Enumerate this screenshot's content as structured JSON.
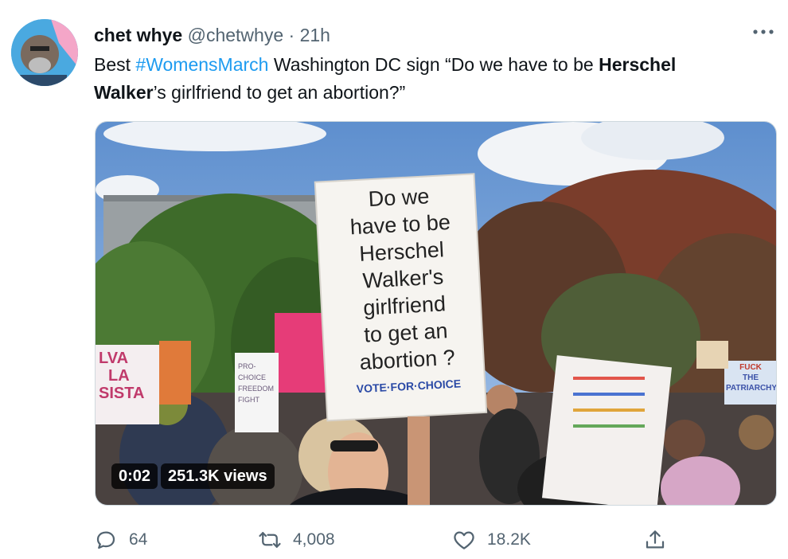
{
  "tweet": {
    "author_name": "chet whye",
    "handle": "@chetwhye",
    "separator": "·",
    "time": "21h",
    "text_part1": "Best ",
    "hashtag": "#WomensMarch",
    "text_part2": " Washington DC sign “Do we have to be ",
    "bold_part1": "Herschel",
    "bold_part2": "Walker",
    "text_part3": "’s girlfriend to get an abortion?”"
  },
  "video": {
    "time": "0:02",
    "views": "251.3K views",
    "sign": {
      "lines": [
        "Do we",
        "have to be",
        "Herschel",
        "Walker's",
        "girlfriend",
        "to get an",
        "abortion ?"
      ],
      "footer": "VOTE·FOR·CHOICE"
    },
    "left_sign": [
      "LVA",
      "LA",
      "SISTA"
    ],
    "small_sign": [
      "PRO-CHOICE",
      "FREEDOM",
      "FIGHT"
    ],
    "right_sign": [
      "FUCK",
      "THE",
      "PATRIARCHY"
    ]
  },
  "actions": {
    "replies": "64",
    "retweets": "4,008",
    "likes": "18.2K"
  },
  "colors": {
    "link": "#1d9bf0",
    "secondary": "#536471"
  },
  "icons": [
    "avatar",
    "more-icon",
    "reply-icon",
    "retweet-icon",
    "like-icon",
    "share-icon"
  ]
}
